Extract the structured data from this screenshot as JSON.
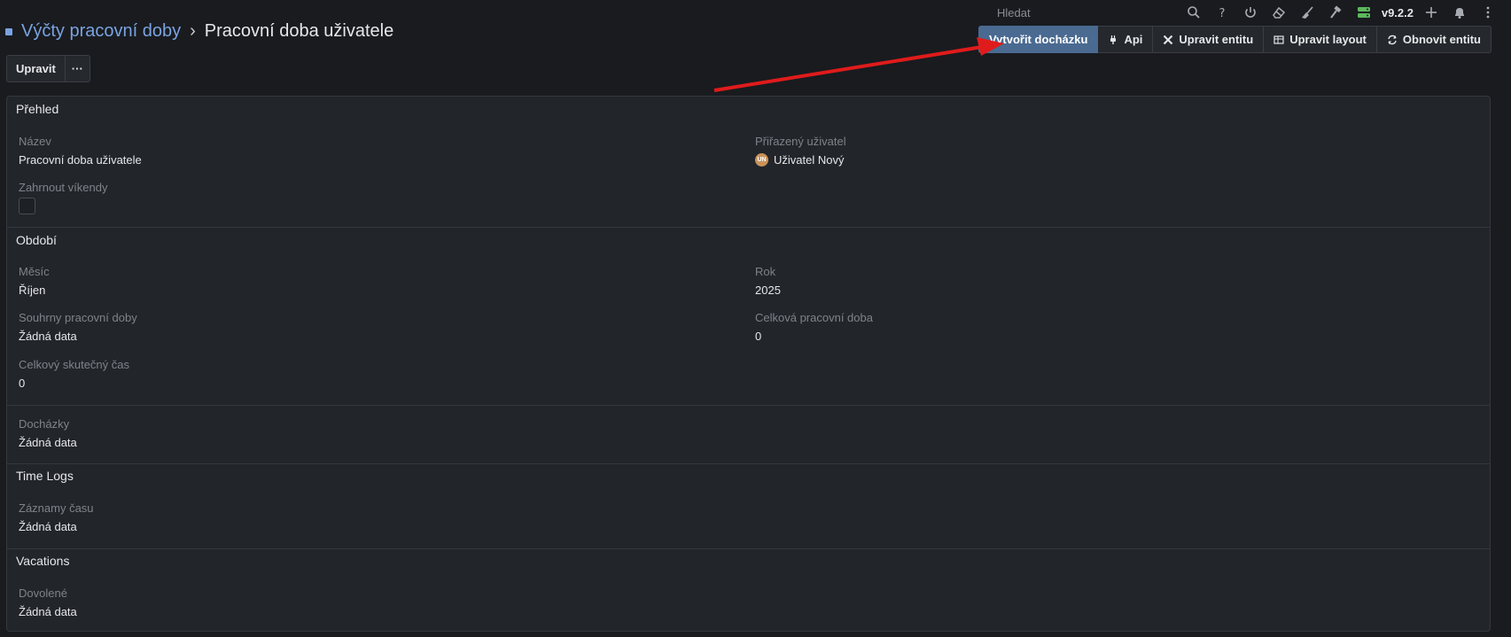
{
  "topbar": {
    "search_placeholder": "Hledat",
    "version": "v9.2.2",
    "icons": [
      "search-icon",
      "help-icon",
      "power-icon",
      "eraser-icon",
      "broom-icon",
      "hammer-icon",
      "server-icon",
      "plus-icon",
      "bell-icon",
      "kebab-icon"
    ]
  },
  "header": {
    "breadcrumb_link": "Výčty pracovní doby",
    "separator": "›",
    "title": "Pracovní doba uživatele"
  },
  "actions": {
    "create_attendance": "Vytvořit docházku",
    "api": "Api",
    "edit_entity": "Upravit entitu",
    "edit_layout": "Upravit layout",
    "refresh_entity": "Obnovit entitu"
  },
  "edit": {
    "edit_label": "Upravit",
    "more_label": "···"
  },
  "sections": {
    "overview": {
      "title": "Přehled",
      "name_label": "Název",
      "name_value": "Pracovní doba uživatele",
      "assigned_label": "Přiřazený uživatel",
      "assigned_initials": "UN",
      "assigned_value": "Uživatel Nový",
      "weekends_label": "Zahrnout víkendy",
      "weekends_checked": false
    },
    "period": {
      "title": "Období",
      "month_label": "Měsíc",
      "month_value": "Říjen",
      "year_label": "Rok",
      "year_value": "2025",
      "summaries_label": "Souhrny pracovní doby",
      "summaries_value": "Žádná data",
      "total_label": "Celková pracovní doba",
      "total_value": "0",
      "actual_label": "Celkový skutečný čas",
      "actual_value": "0"
    },
    "attendance": {
      "label": "Docházky",
      "value": "Žádná data"
    },
    "timelogs": {
      "title": "Time Logs",
      "label": "Záznamy času",
      "value": "Žádná data"
    },
    "vacations": {
      "title": "Vacations",
      "label": "Dovolené",
      "value": "Žádná data"
    }
  },
  "colors": {
    "accent": "#7aa3e0",
    "primary_button": "#4a6a91",
    "annotation_arrow": "#e01b1b"
  }
}
